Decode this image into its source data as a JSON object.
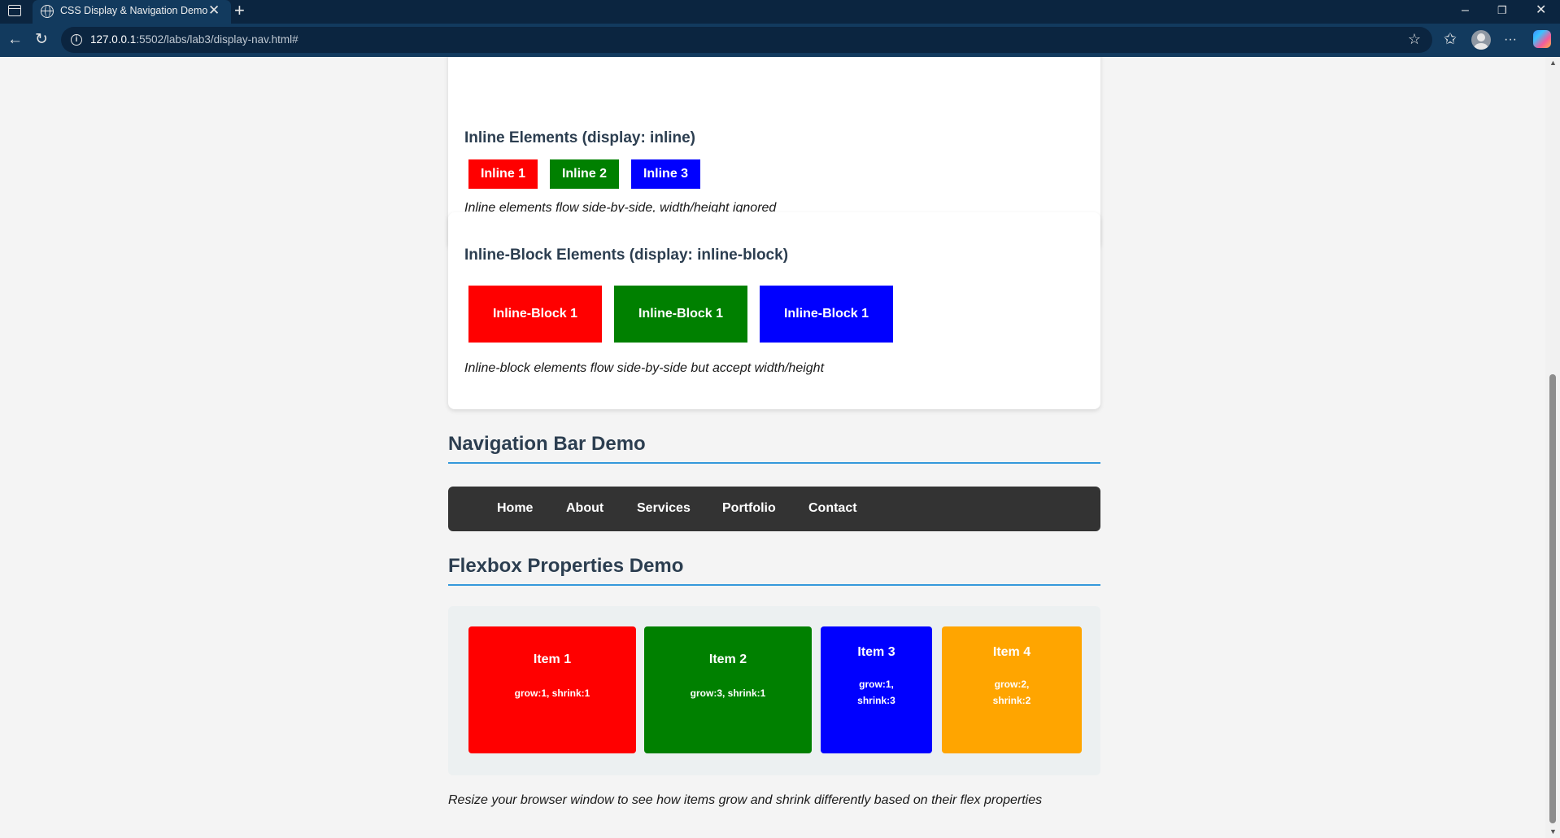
{
  "browser": {
    "tab_title": "CSS Display & Navigation Demo",
    "tab_close": "✕",
    "new_tab": "+",
    "url_host": "127.0.0.1",
    "url_rest": ":5502/labs/lab3/display-nav.html#",
    "info_glyph": "i",
    "minimize": "–",
    "restore": "❐",
    "close": "✕",
    "back": "←",
    "reload": "↻",
    "favorites_star": "☆",
    "collections": "✩",
    "more": "···",
    "icons": [
      "window-icon",
      "globe-icon",
      "back-arrow-icon",
      "reload-icon",
      "info-icon",
      "star-icon",
      "collections-icon",
      "profile-avatar-icon",
      "more-icon",
      "copilot-icon"
    ]
  },
  "inline_section": {
    "title": "Inline Elements (display: inline)",
    "items": [
      "Inline 1",
      "Inline 2",
      "Inline 3"
    ],
    "note": "Inline elements flow side-by-side, width/height ignored"
  },
  "inline_block_section": {
    "title": "Inline-Block Elements (display: inline-block)",
    "items": [
      "Inline-Block 1",
      "Inline-Block 1",
      "Inline-Block 1"
    ],
    "note": "Inline-block elements flow side-by-side but accept width/height"
  },
  "nav_section": {
    "heading": "Navigation Bar Demo",
    "links": [
      "Home",
      "About",
      "Services",
      "Portfolio",
      "Contact"
    ]
  },
  "flex_section": {
    "heading": "Flexbox Properties Demo",
    "items": [
      {
        "title": "Item 1",
        "desc_1": "grow:1, shrink:1",
        "desc_2": ""
      },
      {
        "title": "Item 2",
        "desc_1": "grow:3, shrink:1",
        "desc_2": ""
      },
      {
        "title": "Item 3",
        "desc_1": "grow:1,",
        "desc_2": "shrink:3"
      },
      {
        "title": "Item 4",
        "desc_1": "grow:2,",
        "desc_2": "shrink:2"
      }
    ],
    "note": "Resize your browser window to see how items grow and shrink differently based on their flex properties"
  },
  "colors": {
    "red": "#ff0000",
    "green": "#008000",
    "blue": "#0000ff",
    "orange": "#ffa500",
    "heading": "#2c3e50",
    "accent": "#3498db",
    "navbar": "#333333"
  }
}
